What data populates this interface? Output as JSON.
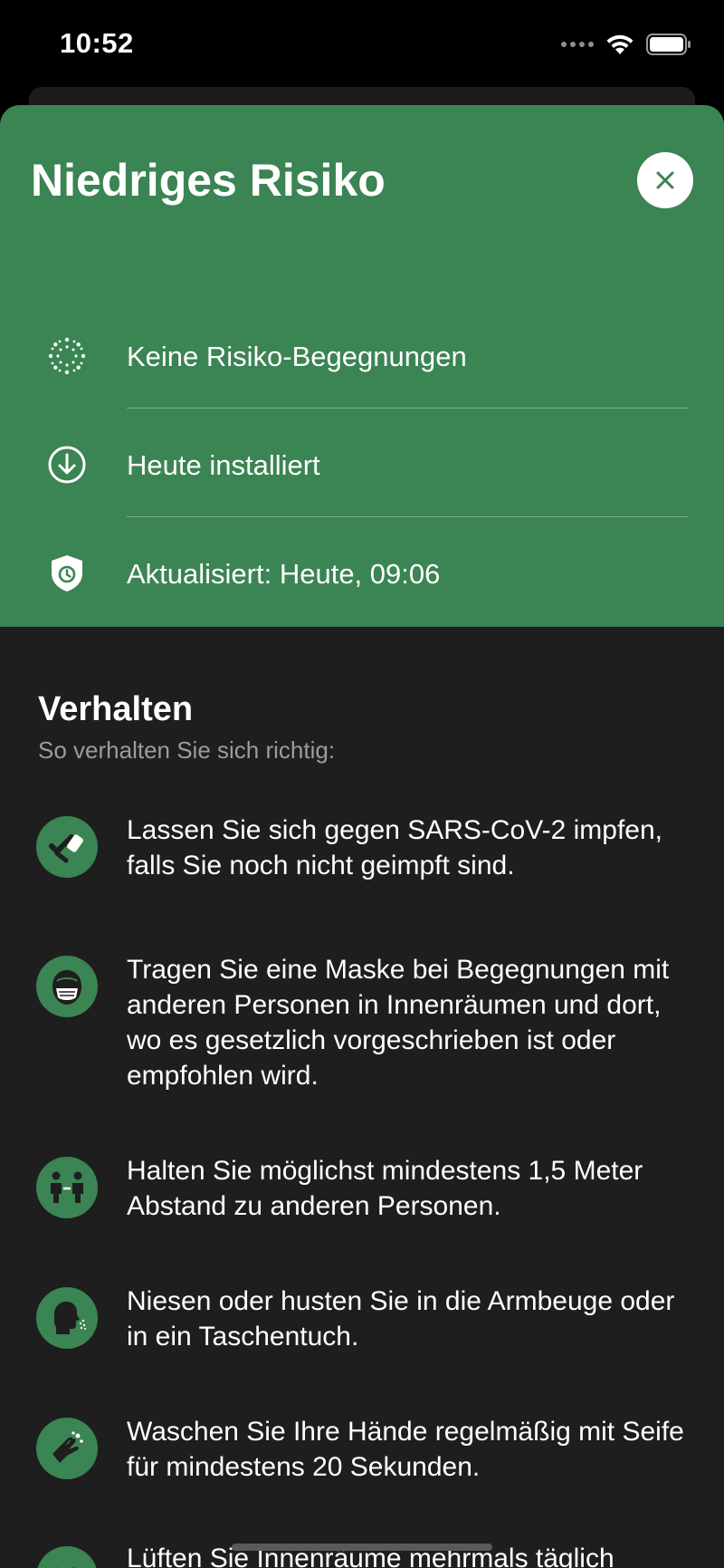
{
  "status_bar": {
    "time": "10:52"
  },
  "header": {
    "title": "Niedriges Risiko",
    "background_color": "#3b8453",
    "rows": [
      {
        "icon": "virus-icon",
        "text": "Keine Risiko-Begegnungen"
      },
      {
        "icon": "download-circle-icon",
        "text": "Heute installiert"
      },
      {
        "icon": "shield-clock-icon",
        "text": "Aktualisiert: Heute, 09:06"
      }
    ]
  },
  "behavior": {
    "title": "Verhalten",
    "subtitle": "So verhalten Sie sich richtig:",
    "tips": [
      {
        "icon": "vaccine-arm-icon",
        "text": "Lassen Sie sich gegen SARS-CoV-2 impfen, falls Sie noch nicht geimpft sind."
      },
      {
        "icon": "face-mask-icon",
        "text": "Tragen Sie eine Maske bei Begegnungen mit anderen Personen in Innenräumen und dort, wo es gesetzlich vorgeschrieben ist oder empfohlen wird."
      },
      {
        "icon": "distance-people-icon",
        "text": "Halten Sie möglichst mindestens 1,5 Meter Abstand zu anderen Personen."
      },
      {
        "icon": "sneeze-icon",
        "text": "Niesen oder husten Sie in die Armbeuge oder in ein Taschentuch."
      },
      {
        "icon": "hand-wash-icon",
        "text": "Waschen Sie Ihre Hände regelmäßig mit Seife für mindestens 20 Sekunden."
      },
      {
        "icon": "ventilation-icon",
        "text": "Lüften Sie Innenräume mehrmals täglich"
      }
    ]
  }
}
